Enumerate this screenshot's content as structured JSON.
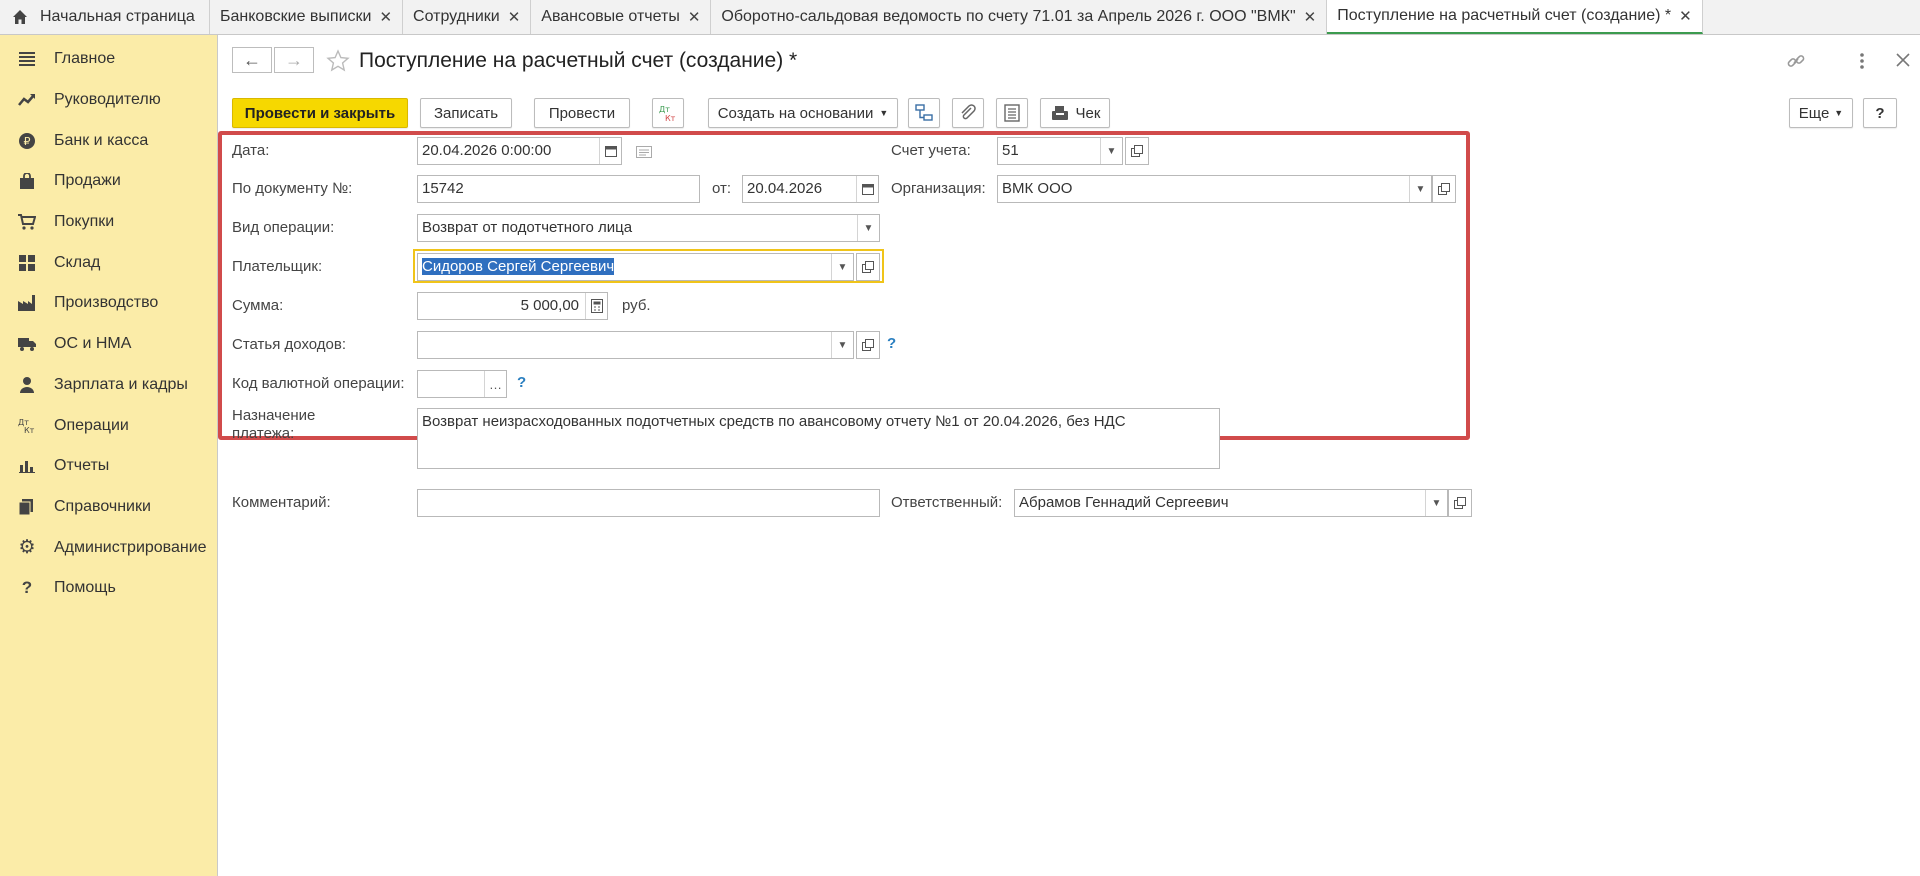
{
  "tabs": {
    "home": "Начальная страница",
    "items": [
      {
        "label": "Банковские выписки",
        "close": "✕"
      },
      {
        "label": "Сотрудники",
        "close": "✕"
      },
      {
        "label": "Авансовые отчеты",
        "close": "✕"
      },
      {
        "label": "Оборотно-сальдовая ведомость по счету 71.01 за Апрель 2026 г. ООО \"ВМК\"",
        "close": "✕"
      },
      {
        "label": "Поступление на расчетный счет (создание) *",
        "close": "✕"
      }
    ]
  },
  "sidebar": {
    "items": [
      {
        "label": "Главное",
        "icon": "menu-icon"
      },
      {
        "label": "Руководителю",
        "icon": "trend-icon"
      },
      {
        "label": "Банк и касса",
        "icon": "ruble-icon"
      },
      {
        "label": "Продажи",
        "icon": "bag-icon"
      },
      {
        "label": "Покупки",
        "icon": "cart-icon"
      },
      {
        "label": "Склад",
        "icon": "warehouse-icon"
      },
      {
        "label": "Производство",
        "icon": "factory-icon"
      },
      {
        "label": "ОС и НМА",
        "icon": "truck-icon"
      },
      {
        "label": "Зарплата и кадры",
        "icon": "person-icon"
      },
      {
        "label": "Операции",
        "icon": "dt-kt-icon"
      },
      {
        "label": "Отчеты",
        "icon": "bar-chart-icon"
      },
      {
        "label": "Справочники",
        "icon": "books-icon"
      },
      {
        "label": "Администрирование",
        "icon": "gear-icon"
      },
      {
        "label": "Помощь",
        "icon": "question-icon"
      }
    ]
  },
  "header": {
    "title": "Поступление на расчетный счет (создание) *",
    "back": "←",
    "forward": "→"
  },
  "toolbar": {
    "post_close": "Провести и закрыть",
    "save": "Записать",
    "post": "Провести",
    "create_basis": "Создать на основании",
    "check": "Чек",
    "more": "Еще",
    "help": "?"
  },
  "form": {
    "date_label": "Дата:",
    "date_value": "20.04.2026  0:00:00",
    "doc_label": "По документу №:",
    "doc_value": "15742",
    "from_label": "от:",
    "from_value": "20.04.2026",
    "operation_label": "Вид операции:",
    "operation_value": "Возврат от подотчетного лица",
    "payer_label": "Плательщик:",
    "payer_value": "Сидоров Сергей Сергеевич",
    "sum_label": "Сумма:",
    "sum_value": "5 000,00",
    "currency": "руб.",
    "income_label": "Статья доходов:",
    "income_value": "",
    "currency_op_label": "Код валютной операции:",
    "currency_op_value": "",
    "purpose_label": "Назначение платежа:",
    "purpose_value": "Возврат неизрасходованных подотчетных средств по авансовому отчету №1 от 20.04.2026, без НДС",
    "account_label": "Счет учета:",
    "account_value": "51",
    "org_label": "Организация:",
    "org_value": "ВМК ООО",
    "comment_label": "Комментарий:",
    "comment_value": "",
    "responsible_label": "Ответственный:",
    "responsible_value": "Абрамов Геннадий Сергеевич",
    "help_mark": "?"
  },
  "colors": {
    "accent_yellow": "#f6d800",
    "sidebar_bg": "#fbeca8",
    "highlight_frame": "#d14b4b",
    "active_field_border": "#f0c419",
    "selection": "#2f6fbf"
  }
}
